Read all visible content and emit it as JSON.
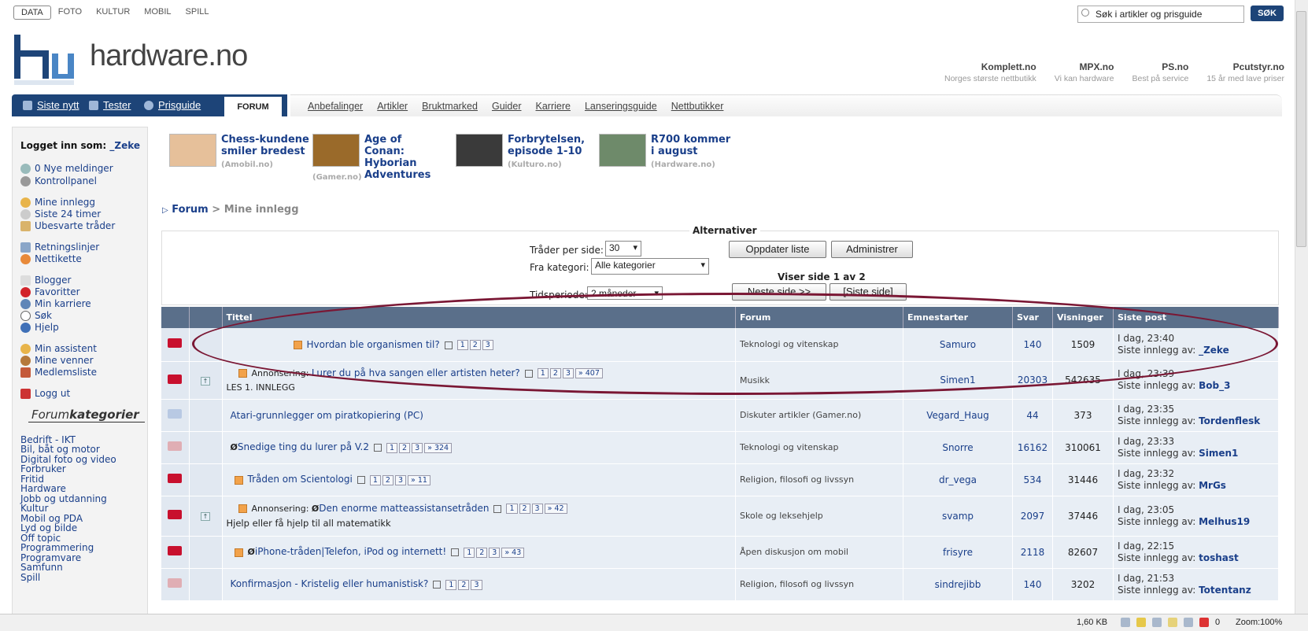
{
  "toplinks": [
    "DATA",
    "FOTO",
    "KULTUR",
    "MOBIL",
    "SPILL"
  ],
  "search": {
    "placeholder": "Søk i artikler og prisguide",
    "button": "SØK"
  },
  "logo": "hardware.no",
  "shops": [
    {
      "name": "Komplett.no",
      "tag": "Norges største nettbutikk"
    },
    {
      "name": "MPX.no",
      "tag": "Vi kan hardware"
    },
    {
      "name": "PS.no",
      "tag": "Best på service"
    },
    {
      "name": "Pcutstyr.no",
      "tag": "15 år med lave priser"
    }
  ],
  "mainnav": [
    "Siste nytt",
    "Tester",
    "Prisguide"
  ],
  "forum_tab": "FORUM",
  "subnav": [
    "Anbefalinger",
    "Artikler",
    "Bruktmarked",
    "Guider",
    "Karriere",
    "Lanseringsguide",
    "Nettbutikker"
  ],
  "sidebar": {
    "logged_label": "Logget inn som:",
    "user": "_Zeke",
    "links": [
      "0 Nye meldinger",
      "Kontrollpanel",
      "Mine innlegg",
      "Siste 24 timer",
      "Ubesvarte tråder",
      "Retningslinjer",
      "Nettikette",
      "Blogger",
      "Favoritter",
      "Min karriere",
      "Søk",
      "Hjelp",
      "Min assistent",
      "Mine venner",
      "Medlemsliste",
      "Logg ut"
    ],
    "cat_heading_a": "Forum",
    "cat_heading_b": "kategorier",
    "categories": [
      "Bedrift - IKT",
      "Bil, båt og motor",
      "Digital foto og video",
      "Forbruker",
      "Fritid",
      "Hardware",
      "Jobb og utdanning",
      "Kultur",
      "Mobil og PDA",
      "Lyd og bilde",
      "Off topic",
      "Programmering",
      "Programvare",
      "Samfunn",
      "Spill"
    ]
  },
  "news": [
    {
      "title": "Chess-kundene smiler bredest",
      "source": "(Amobil.no)"
    },
    {
      "title": "Age of Conan: Hyborian Adventures",
      "source": "(Gamer.no)"
    },
    {
      "title": "Forbrytelsen, episode 1-10",
      "source": "(Kulturo.no)"
    },
    {
      "title": "R700 kommer i august",
      "source": "(Hardware.no)"
    }
  ],
  "breadcrumb": {
    "root": "Forum",
    "sep": ">",
    "current": "Mine innlegg"
  },
  "alternatives": {
    "title": "Alternativer",
    "per_page_label": "Tråder per side:",
    "per_page_value": "30",
    "category_label": "Fra kategori:",
    "category_value": "Alle kategorier",
    "period_label": "Tidsperiode:",
    "period_value": "2 måneder",
    "update_btn": "Oppdater liste",
    "admin_btn": "Administrer",
    "page_info": "Viser side 1 av 2",
    "next_btn": "Neste side >>",
    "last_btn": "[Siste side]"
  },
  "table": {
    "headers": [
      "Tittel",
      "Forum",
      "Emnestarter",
      "Svar",
      "Visninger",
      "Siste post"
    ],
    "last_by": "Siste innlegg av:",
    "rows": [
      {
        "title": "Hvordan ble organismen til?",
        "prefix": "",
        "sub": "",
        "pages": [
          "1",
          "2",
          "3"
        ],
        "forum": "Teknologi og vitenskap",
        "starter": "Samuro",
        "replies": "140",
        "views": "1509",
        "time": "I dag, 23:40",
        "user": "_Zeke"
      },
      {
        "title": "Lurer du på hva sangen eller artisten heter?",
        "prefix": "Annonsering:",
        "sub": "LES 1. INNLEGG",
        "pages": [
          "1",
          "2",
          "3",
          "» 407"
        ],
        "forum": "Musikk",
        "starter": "Simen1",
        "replies": "20303",
        "views": "542635",
        "time": "I dag, 23:39",
        "user": "Bob_3"
      },
      {
        "title": "Atari-grunnlegger om piratkopiering (PC)",
        "prefix": "",
        "sub": "",
        "pages": [],
        "forum": "Diskuter artikler (Gamer.no)",
        "starter": "Vegard_Haug",
        "replies": "44",
        "views": "373",
        "time": "I dag, 23:35",
        "user": "Tordenflesk"
      },
      {
        "title": "Snedige ting du lurer på V.2",
        "prefix": "",
        "sub": "",
        "pages": [
          "1",
          "2",
          "3",
          "» 324"
        ],
        "forum": "Teknologi og vitenskap",
        "starter": "Snorre",
        "replies": "16162",
        "views": "310061",
        "time": "I dag, 23:33",
        "user": "Simen1"
      },
      {
        "title": "Tråden om Scientologi",
        "prefix": "",
        "sub": "",
        "pages": [
          "1",
          "2",
          "3",
          "» 11"
        ],
        "forum": "Religion, filosofi og livssyn",
        "starter": "dr_vega",
        "replies": "534",
        "views": "31446",
        "time": "I dag, 23:32",
        "user": "MrGs"
      },
      {
        "title": "Den enorme matteassistansetråden",
        "prefix": "Annonsering:",
        "sub": "Hjelp eller få hjelp til all matematikk",
        "pages": [
          "1",
          "2",
          "3",
          "» 42"
        ],
        "forum": "Skole og leksehjelp",
        "starter": "svamp",
        "replies": "2097",
        "views": "37446",
        "time": "I dag, 23:05",
        "user": "Melhus19"
      },
      {
        "title": "iPhone-tråden|Telefon, iPod og internett!",
        "prefix": "",
        "sub": "",
        "pages": [
          "1",
          "2",
          "3",
          "» 43"
        ],
        "forum": "Åpen diskusjon om mobil",
        "starter": "frisyre",
        "replies": "2118",
        "views": "82607",
        "time": "I dag, 22:15",
        "user": "toshast"
      },
      {
        "title": "Konfirmasjon - Kristelig eller humanistisk?",
        "prefix": "",
        "sub": "",
        "pages": [
          "1",
          "2",
          "3"
        ],
        "forum": "Religion, filosofi og livssyn",
        "starter": "sindrejibb",
        "replies": "140",
        "views": "3202",
        "time": "I dag, 21:53",
        "user": "Totentanz"
      }
    ]
  },
  "statusbar": {
    "size": "1,60 KB",
    "count": "0",
    "zoom": "Zoom:100%"
  }
}
